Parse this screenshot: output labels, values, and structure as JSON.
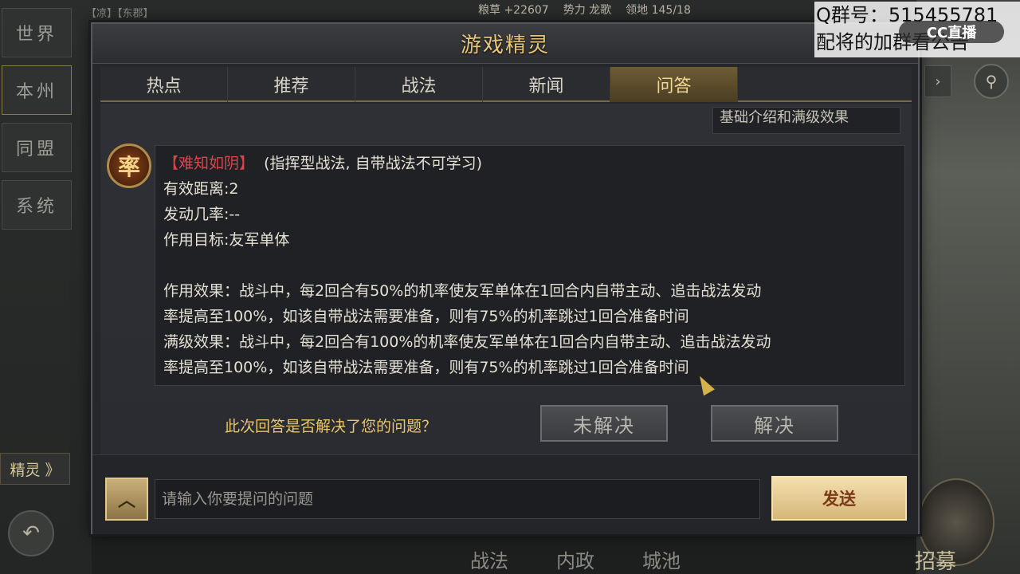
{
  "left_menu": {
    "items": [
      {
        "label": "世界"
      },
      {
        "label": "本州"
      },
      {
        "label": "同盟"
      },
      {
        "label": "系统"
      }
    ],
    "spirit_tab": "精灵 》"
  },
  "top_bar": {
    "chat_snippet": "【凉】【东郡】",
    "grain": "粮草 +22607",
    "force": "势力 龙歌",
    "territory": "领地 145/18"
  },
  "watermark": {
    "line1": "Q群号：515455781",
    "line2": "配将的加群看公告",
    "logo": "CC直播"
  },
  "dialog": {
    "title": "游戏精灵",
    "tabs": [
      {
        "label": "热点"
      },
      {
        "label": "推荐"
      },
      {
        "label": "战法"
      },
      {
        "label": "新闻"
      },
      {
        "label": "问答"
      }
    ],
    "active_tab": "问答",
    "previous_message": "基础介绍和满级效果",
    "avatar_char": "率",
    "answer": {
      "skill_name": "【难知如阴】",
      "skill_type": "(指挥型战法, 自带战法不可学习)",
      "range": "有效距离:2",
      "trigger_rate": "发动几率:--",
      "target": "作用目标:友军单体",
      "effect_line1": "作用效果：战斗中，每2回合有50%的机率使友军单体在1回合内自带主动、追击战法发动",
      "effect_line2": "率提高至100%，如该自带战法需要准备，则有75%的机率跳过1回合准备时间",
      "max_line1": "满级效果：战斗中，每2回合有100%的机率使友军单体在1回合内自带主动、追击战法发动",
      "max_line2": "率提高至100%，如该自带战法需要准备，则有75%的机率跳过1回合准备时间"
    },
    "feedback": {
      "question": "此次回答是否解决了您的问题？",
      "unsolved": "未解决",
      "solved": "解决"
    },
    "input": {
      "placeholder": "请输入你要提问的问题",
      "value": ""
    },
    "send_label": "发送"
  },
  "bottom_nav": {
    "items": [
      "战法",
      "内政",
      "城池"
    ],
    "recruit": "招募"
  },
  "colors": {
    "accent_gold": "#e7c57a",
    "skill_red": "#e0424a",
    "question_gold": "#e9c66a"
  }
}
